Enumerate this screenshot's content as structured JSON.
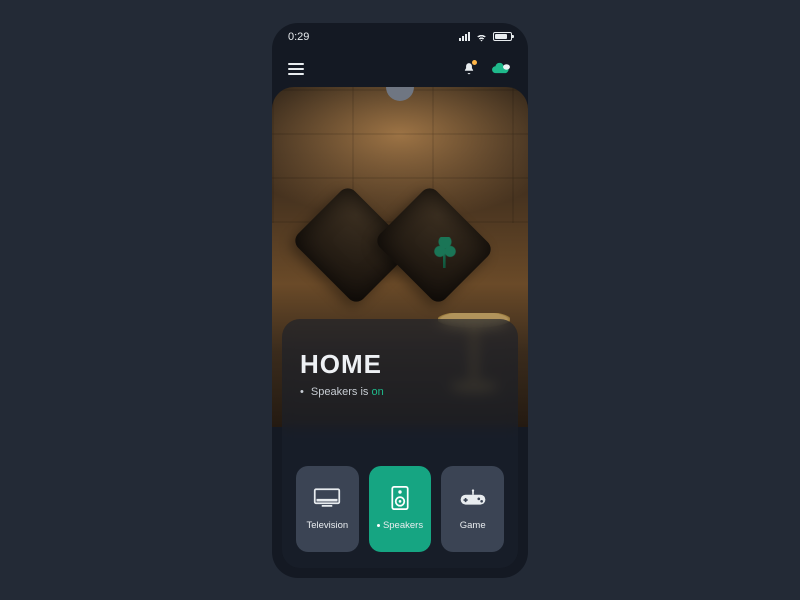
{
  "status": {
    "time": "0:29"
  },
  "header": {
    "menu_icon": "hamburger-icon",
    "bell_icon": "bell-icon",
    "weather_icon": "cloud-icon"
  },
  "card": {
    "title": "HOME",
    "status_prefix": "Speakers is",
    "status_value": "on"
  },
  "tiles": [
    {
      "label": "Television",
      "icon": "tv-icon",
      "active": false
    },
    {
      "label": "Speakers",
      "icon": "speaker-icon",
      "active": true
    },
    {
      "label": "Game",
      "icon": "gamepad-icon",
      "active": false
    }
  ],
  "colors": {
    "accent": "#16a582",
    "bg": "#232a36"
  }
}
